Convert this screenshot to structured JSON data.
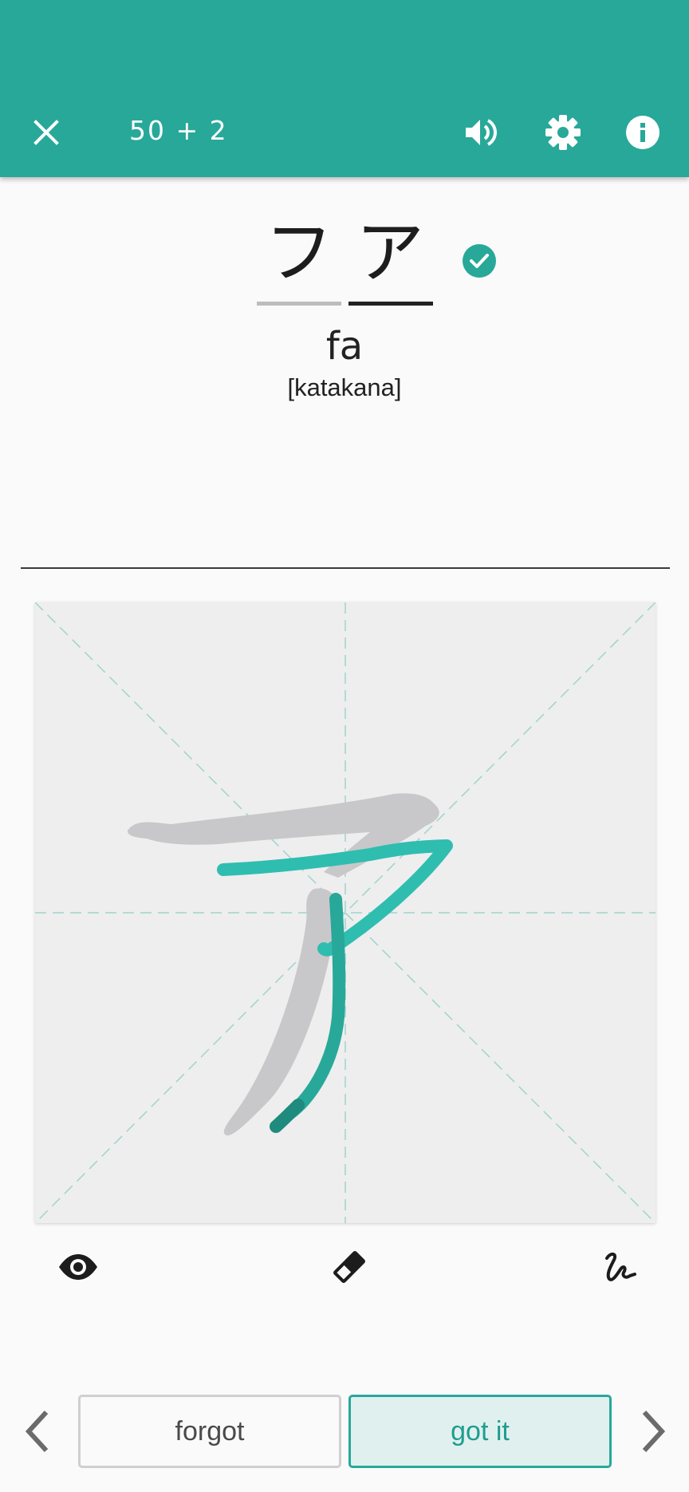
{
  "header": {
    "counter": "50 + 2",
    "icons": {
      "close": "close-icon",
      "sound": "volume-icon",
      "settings": "gear-icon",
      "info": "info-icon"
    }
  },
  "card": {
    "characters": [
      "フ",
      "ア"
    ],
    "romaji": "fa",
    "kind": "[katakana]",
    "status_icon": "check-circle-icon"
  },
  "tools": {
    "reveal": "eye-icon",
    "erase": "eraser-icon",
    "stroke_mode": "scribble-icon"
  },
  "actions": {
    "forgot_label": "forgot",
    "got_it_label": "got it",
    "prev": "chevron-left-icon",
    "next": "chevron-right-icon"
  },
  "colors": {
    "accent": "#28a899",
    "guide_stroke": "#c8c8cb",
    "user_stroke": "#2dbfb0"
  }
}
